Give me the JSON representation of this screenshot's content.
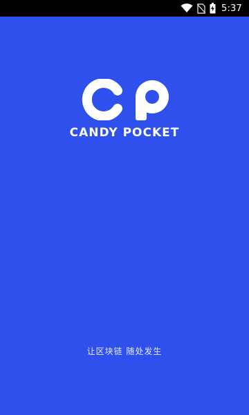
{
  "status_bar": {
    "time": "5:37",
    "icons": [
      "wifi-icon",
      "no-sim-icon",
      "battery-charging-icon"
    ]
  },
  "splash": {
    "logo_letters": "CP",
    "brand_name": "CANDY POCKET",
    "tagline": "让区块链 随处发生"
  },
  "colors": {
    "background": "#2f50ec",
    "status_bar": "#000000",
    "logo": "#ffffff"
  }
}
